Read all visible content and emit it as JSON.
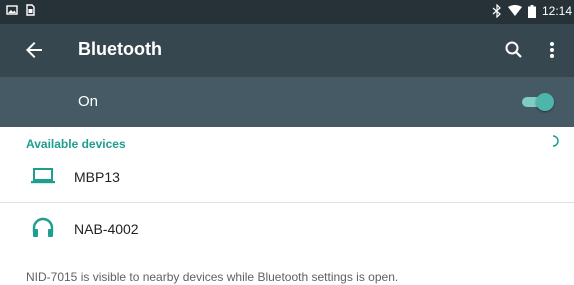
{
  "status_bar": {
    "time": "12:14",
    "icons": [
      "image-icon",
      "sim-icon",
      "bluetooth-icon",
      "wifi-icon",
      "battery-icon"
    ]
  },
  "app_bar": {
    "title": "Bluetooth",
    "icons": [
      "back-arrow-icon",
      "search-icon",
      "more-vert-icon"
    ]
  },
  "toggle": {
    "label": "On",
    "checked": true
  },
  "available": {
    "header": "Available devices",
    "devices": [
      {
        "name": "MBP13",
        "icon": "laptop-icon"
      },
      {
        "name": "NAB-4002",
        "icon": "headphones-icon"
      }
    ]
  },
  "footer_text": "NID-7015 is visible to nearby devices while Bluetooth settings is open.",
  "colors": {
    "status_bar": "#263238",
    "app_bar": "#37474F",
    "toggle_row": "#455A64",
    "accent": "#1E9E8E",
    "switch_thumb": "#4DB6AC"
  }
}
